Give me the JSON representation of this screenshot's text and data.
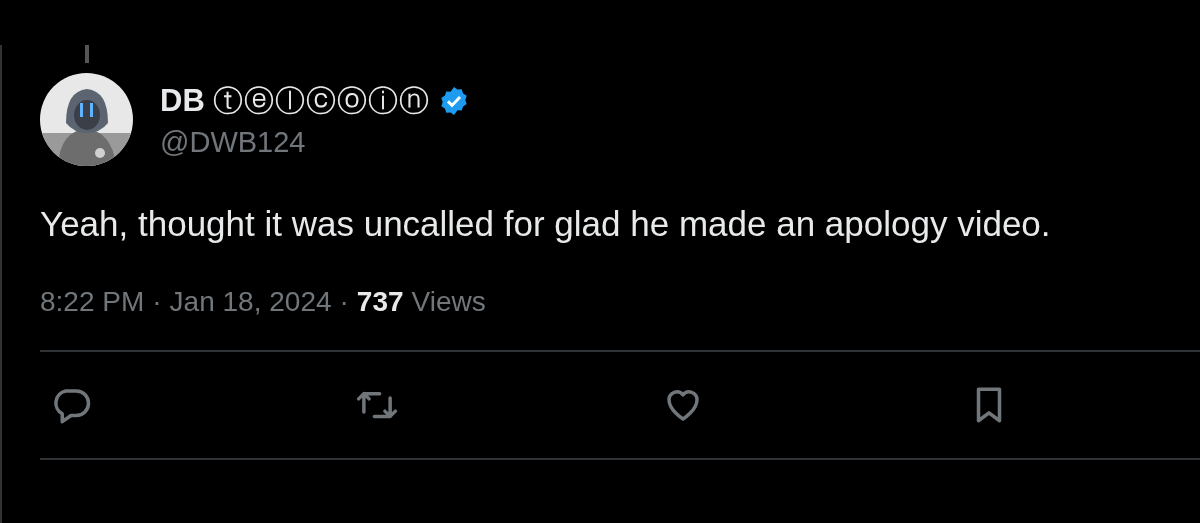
{
  "author": {
    "name": "DB",
    "name_decoration": "ⓣⓔⓛⓒⓞⓘⓝ",
    "verified": true,
    "handle": "@DWB124"
  },
  "text": "Yeah, thought it was uncalled for glad he made an apology video.",
  "meta": {
    "separator": "·",
    "time": "8:22 PM",
    "date": "Jan 18, 2024",
    "views_count": "737",
    "views_label": "Views"
  },
  "actions": [
    {
      "kind": "reply"
    },
    {
      "kind": "repost"
    },
    {
      "kind": "like"
    },
    {
      "kind": "bookmark"
    }
  ]
}
